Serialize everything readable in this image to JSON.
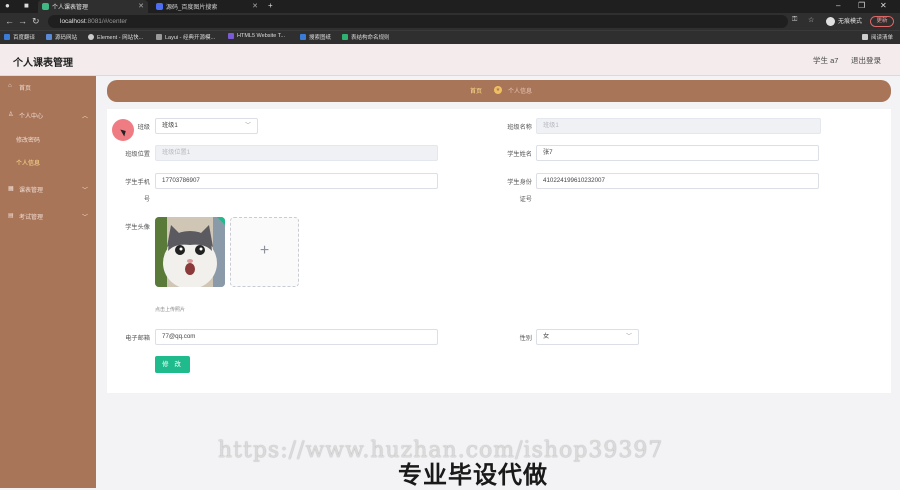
{
  "browser": {
    "tabs": [
      {
        "label": "个人课表管理",
        "active": true
      },
      {
        "label": "源码_百度图片搜索",
        "active": false
      }
    ],
    "url_host": "localhost",
    "url_path": ":8081/#/center",
    "profile_label": "无痕模式",
    "update_label": "更新",
    "bookmarks": [
      "百度翻译",
      "源码网站",
      "Element - 网站快...",
      "Layui - 经典开源模...",
      "HTML5 Website T...",
      "搜索图纸",
      "表结构命名规则"
    ],
    "reading_list": "阅读清单"
  },
  "app": {
    "title": "个人课表管理",
    "user": "学生 a7",
    "logout": "退出登录"
  },
  "sidebar": {
    "items": [
      {
        "label": "首页",
        "icon": "home-icon"
      },
      {
        "label": "个人中心",
        "icon": "user-icon"
      },
      {
        "label": "修改密码",
        "icon": ""
      },
      {
        "label": "个人信息",
        "icon": ""
      },
      {
        "label": "课表管理",
        "icon": "grid-icon"
      },
      {
        "label": "考试管理",
        "icon": "doc-icon"
      }
    ]
  },
  "breadcrumb": {
    "home": "首页",
    "current": "个人信息"
  },
  "form": {
    "class_label": "班级",
    "class_value": "班级1",
    "class_name_label": "班级名称",
    "class_name_placeholder": "班级1",
    "class_location_label": "班级位置",
    "class_location_placeholder": "班级位置1",
    "student_name_label": "学生姓名",
    "student_name_value": "张7",
    "phone_label_1": "学生手机",
    "phone_label_2": "号",
    "phone_value": "17703786907",
    "id_label_1": "学生身份",
    "id_label_2": "证号",
    "id_value": "410224199610232007",
    "avatar_label": "学生头像",
    "upload_tip": "点击上传照片",
    "email_label": "电子邮箱",
    "email_value": "77@qq.com",
    "gender_label": "性别",
    "gender_value": "女",
    "submit_label": "修 改"
  },
  "watermark": {
    "url": "https://www.huzhan.com/ishop39397",
    "text": "专业毕设代做"
  },
  "colors": {
    "sidebar": "#a87559",
    "accent_text": "#ffe08a",
    "submit": "#1fbb8c"
  }
}
